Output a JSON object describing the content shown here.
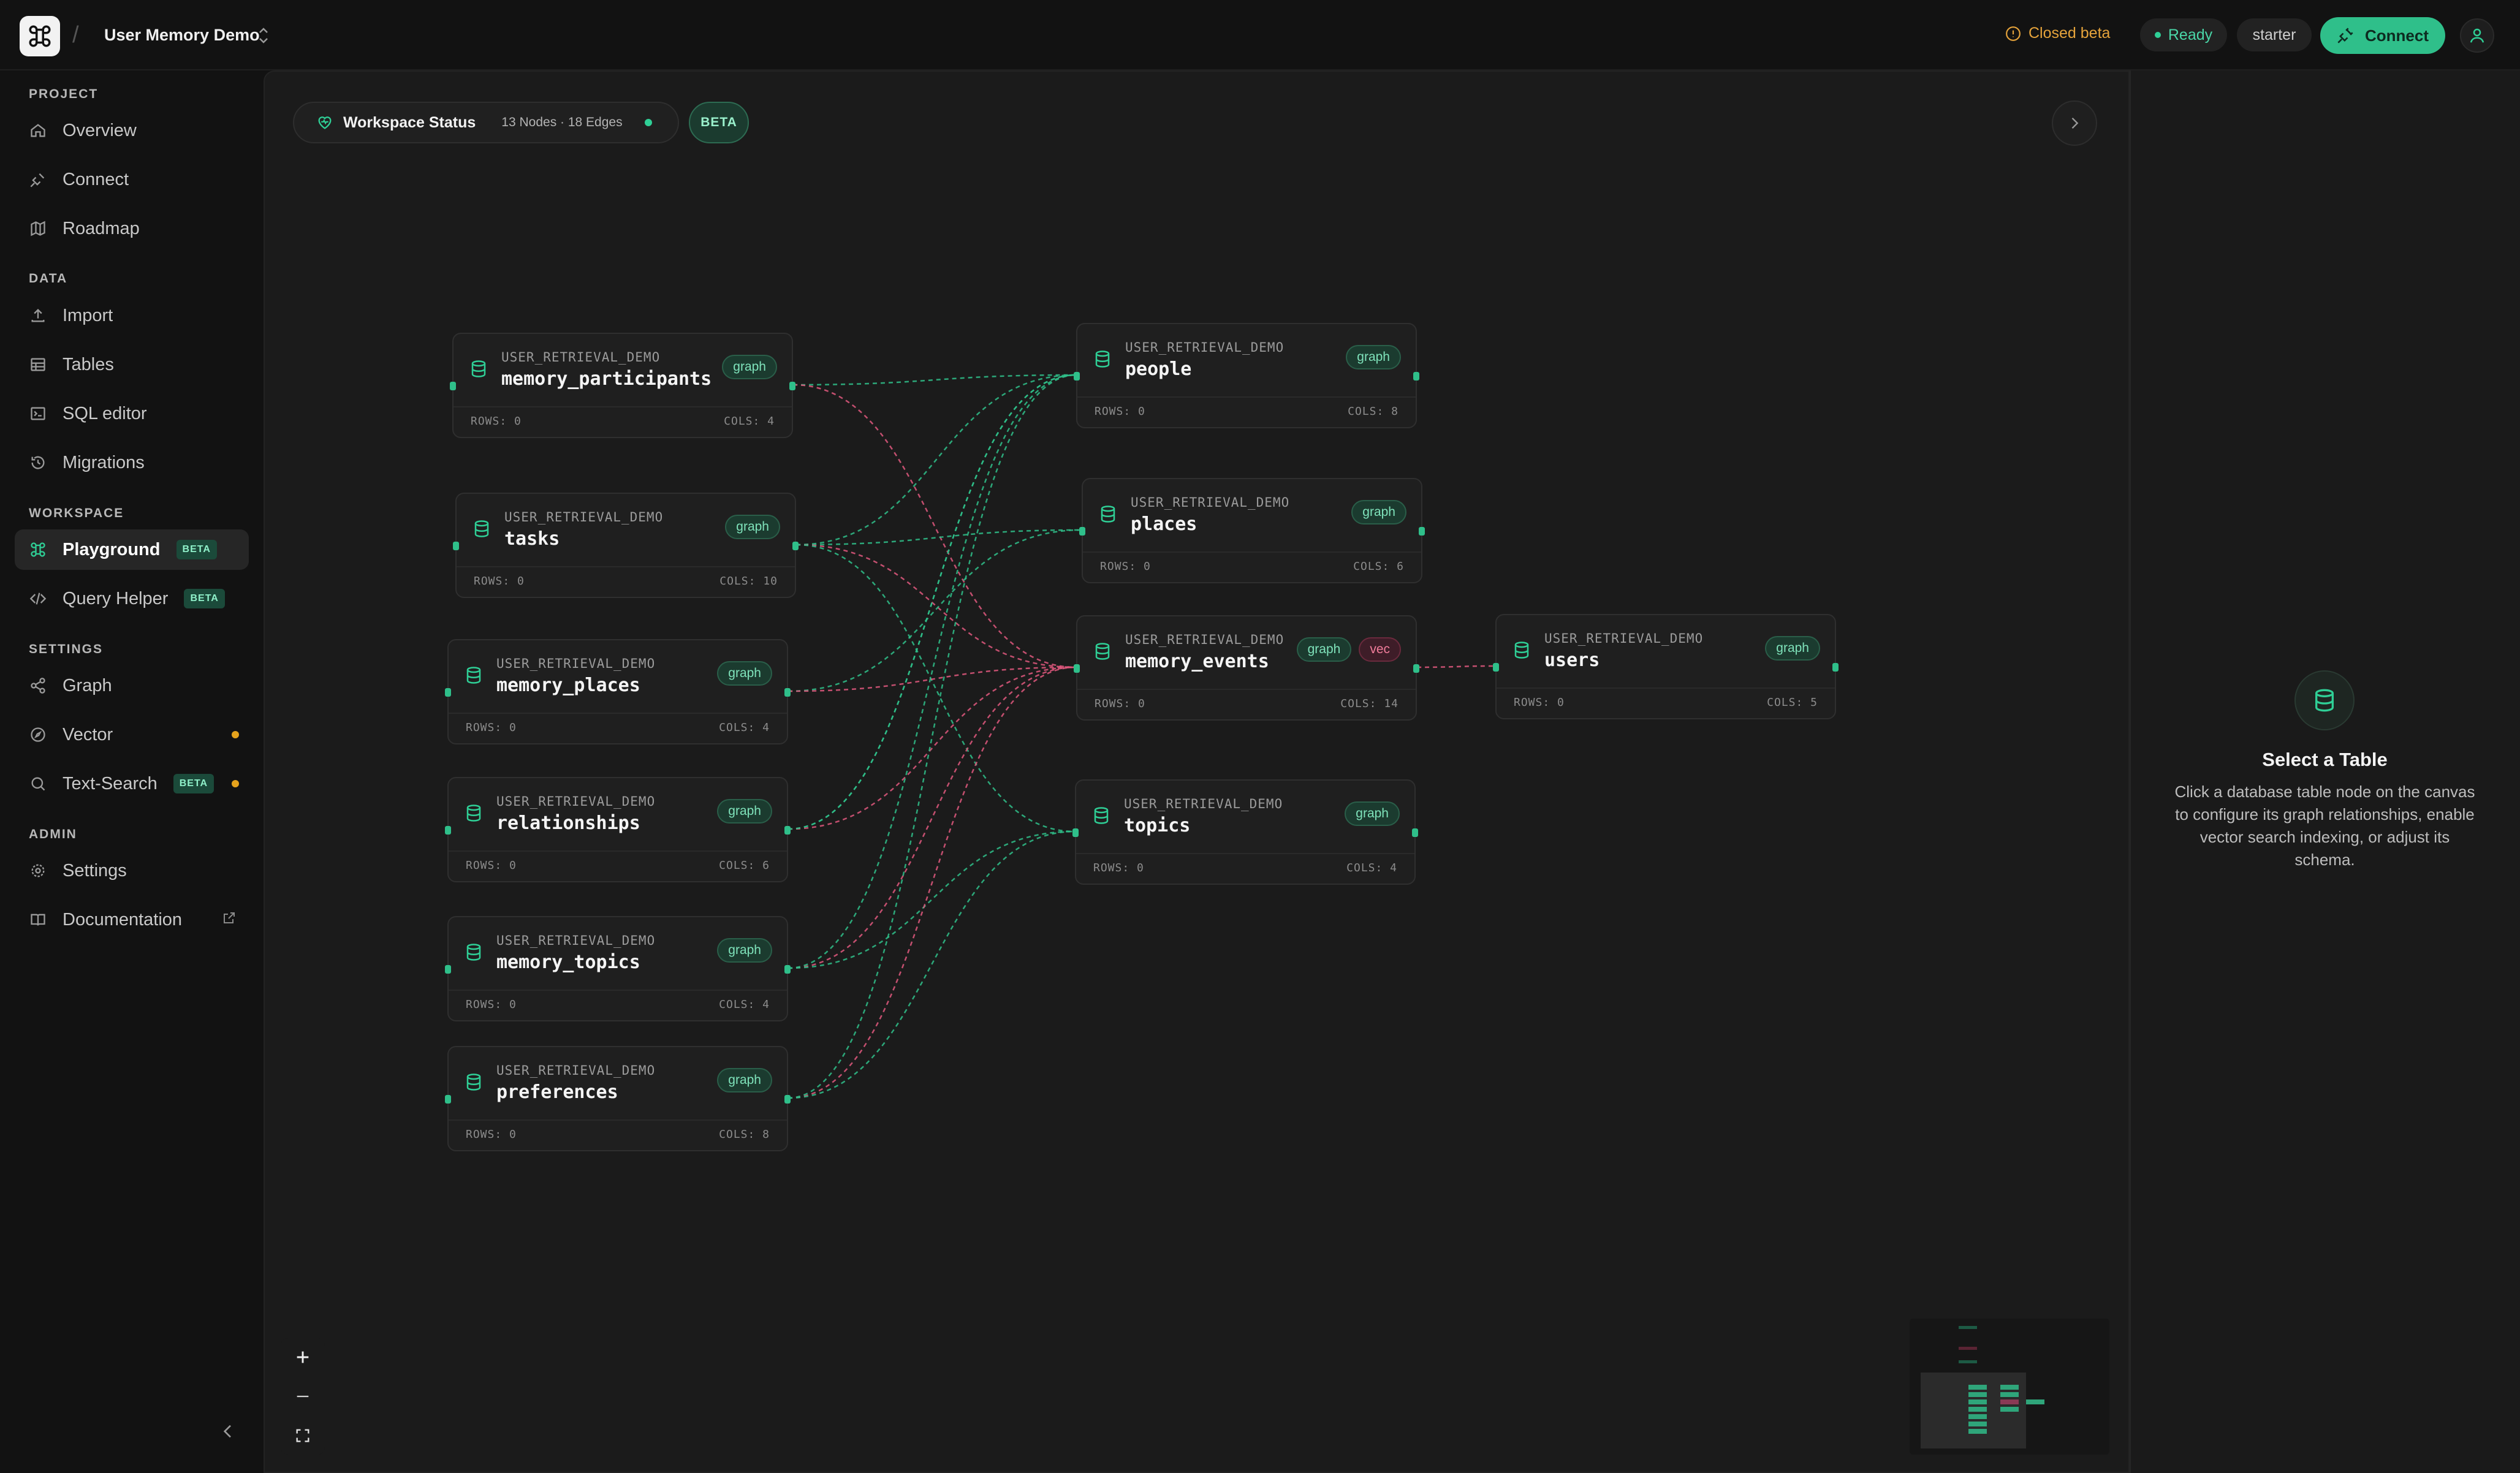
{
  "header": {
    "project_name": "User Memory Demo",
    "closed_beta": "Closed beta",
    "status": "Ready",
    "plan": "starter",
    "connect_label": "Connect"
  },
  "sidebar": {
    "sections": {
      "project": "PROJECT",
      "data": "DATA",
      "workspace": "WORKSPACE",
      "settings": "SETTINGS",
      "admin": "ADMIN"
    },
    "items": {
      "overview": "Overview",
      "connect": "Connect",
      "roadmap": "Roadmap",
      "import": "Import",
      "tables": "Tables",
      "sql_editor": "SQL editor",
      "migrations": "Migrations",
      "playground": "Playground",
      "query_helper": "Query Helper",
      "graph": "Graph",
      "vector": "Vector",
      "text_search": "Text-Search",
      "settings": "Settings",
      "documentation": "Documentation"
    },
    "beta_label": "BETA",
    "active_item": "Playground",
    "status_color": "#e5a21c"
  },
  "canvas": {
    "workspace_status": "Workspace Status",
    "meta": "13 Nodes · 18 Edges",
    "beta": "BETA",
    "accent": "#2fbf8a",
    "vector_accent": "#e0587e",
    "nodes": [
      {
        "schema": "USER_RETRIEVAL_DEMO",
        "name": "memory_participants",
        "badges": [
          "graph"
        ],
        "rows": "ROWS: 0",
        "cols": "COLS: 4"
      },
      {
        "schema": "USER_RETRIEVAL_DEMO",
        "name": "tasks",
        "badges": [
          "graph"
        ],
        "rows": "ROWS: 0",
        "cols": "COLS: 10"
      },
      {
        "schema": "USER_RETRIEVAL_DEMO",
        "name": "memory_places",
        "badges": [
          "graph"
        ],
        "rows": "ROWS: 0",
        "cols": "COLS: 4"
      },
      {
        "schema": "USER_RETRIEVAL_DEMO",
        "name": "relationships",
        "badges": [
          "graph"
        ],
        "rows": "ROWS: 0",
        "cols": "COLS: 6"
      },
      {
        "schema": "USER_RETRIEVAL_DEMO",
        "name": "memory_topics",
        "badges": [
          "graph"
        ],
        "rows": "ROWS: 0",
        "cols": "COLS: 4"
      },
      {
        "schema": "USER_RETRIEVAL_DEMO",
        "name": "preferences",
        "badges": [
          "graph"
        ],
        "rows": "ROWS: 0",
        "cols": "COLS: 8"
      },
      {
        "schema": "USER_RETRIEVAL_DEMO",
        "name": "people",
        "badges": [
          "graph"
        ],
        "rows": "ROWS: 0",
        "cols": "COLS: 8"
      },
      {
        "schema": "USER_RETRIEVAL_DEMO",
        "name": "places",
        "badges": [
          "graph"
        ],
        "rows": "ROWS: 0",
        "cols": "COLS: 6"
      },
      {
        "schema": "USER_RETRIEVAL_DEMO",
        "name": "memory_events",
        "badges": [
          "graph",
          "vec"
        ],
        "rows": "ROWS: 0",
        "cols": "COLS: 14"
      },
      {
        "schema": "USER_RETRIEVAL_DEMO",
        "name": "topics",
        "badges": [
          "graph"
        ],
        "rows": "ROWS: 0",
        "cols": "COLS: 4"
      },
      {
        "schema": "USER_RETRIEVAL_DEMO",
        "name": "users",
        "badges": [
          "graph"
        ],
        "rows": "ROWS: 0",
        "cols": "COLS: 5"
      }
    ]
  },
  "right_panel": {
    "title": "Select a Table",
    "description": "Click a database table node on the canvas to configure its graph relationships, enable vector search indexing, or adjust its schema."
  }
}
